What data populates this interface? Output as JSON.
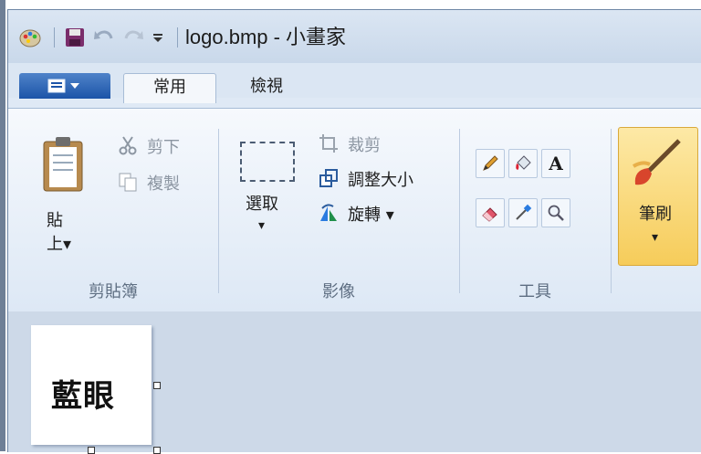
{
  "window": {
    "title": "logo.bmp - 小畫家"
  },
  "quick_access": {
    "items": [
      "paint-app-icon",
      "save-icon",
      "undo-icon",
      "redo-icon",
      "customize-qat-icon"
    ]
  },
  "tabs": {
    "active": "常用",
    "view": "檢視"
  },
  "clipboard": {
    "paste_label_line1": "貼",
    "paste_label_line2": "上▾",
    "cut": "剪下",
    "copy": "複製",
    "group_label": "剪貼簿"
  },
  "image": {
    "select_label": "選取",
    "select_arrow": "▾",
    "crop": "裁剪",
    "resize": "調整大小",
    "rotate": "旋轉 ▾",
    "group_label": "影像"
  },
  "tools": {
    "group_label": "工具",
    "items": [
      "pencil-icon",
      "fill-icon",
      "text-icon",
      "eraser-icon",
      "color-picker-icon",
      "magnifier-icon"
    ],
    "text_glyph": "A"
  },
  "brushes": {
    "label": "筆刷",
    "arrow": "▾"
  },
  "canvas": {
    "text": "藍眼"
  },
  "colors": {
    "accent": "#1c54a8",
    "ribbon": "#eef3f9",
    "highlight": "#f6cc5a"
  }
}
